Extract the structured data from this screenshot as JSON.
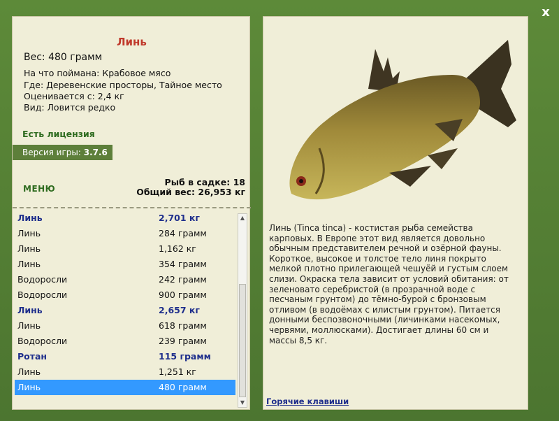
{
  "window": {
    "close_label": "x"
  },
  "fish_card": {
    "title": "Линь",
    "weight": "Вес: 480 грамм",
    "caught_on": "На что поймана: Крабовое мясо",
    "location": "Где: Деревенские просторы, Тайное место",
    "valued_from": "Оценивается с: 2,4 кг",
    "kind": "Вид: Ловится редко"
  },
  "license": "Есть лицензия",
  "version": {
    "label": "Версия игры:",
    "value": "3.7.6"
  },
  "menu_label": "МЕНЮ",
  "stats": {
    "fish_in_keepnet": "Рыб в садке: 18",
    "total_weight": "Общий вес: 26,953 кг"
  },
  "catch_list": [
    {
      "name": "Линь",
      "weight": "2,701 кг",
      "bold": true,
      "selected": false
    },
    {
      "name": "Линь",
      "weight": "284 грамм",
      "bold": false,
      "selected": false
    },
    {
      "name": "Линь",
      "weight": "1,162 кг",
      "bold": false,
      "selected": false
    },
    {
      "name": "Линь",
      "weight": "354 грамм",
      "bold": false,
      "selected": false
    },
    {
      "name": "Водоросли",
      "weight": "242 грамм",
      "bold": false,
      "selected": false
    },
    {
      "name": "Водоросли",
      "weight": "900 грамм",
      "bold": false,
      "selected": false
    },
    {
      "name": "Линь",
      "weight": "2,657 кг",
      "bold": true,
      "selected": false
    },
    {
      "name": "Линь",
      "weight": "618 грамм",
      "bold": false,
      "selected": false
    },
    {
      "name": "Водоросли",
      "weight": "239 грамм",
      "bold": false,
      "selected": false
    },
    {
      "name": "Ротан",
      "weight": "115 грамм",
      "bold": true,
      "selected": false
    },
    {
      "name": "Линь",
      "weight": "1,251 кг",
      "bold": false,
      "selected": false
    },
    {
      "name": "Линь",
      "weight": "480 грамм",
      "bold": false,
      "selected": true
    }
  ],
  "description": "Линь (Tinca tinca) - костистая рыба семейства карповых. В Европе этот вид является довольно обычным представителем речной и озёрной фауны. Короткое, высокое и толстое тело линя покрыто мелкой плотно прилегающей чешуёй и густым слоем слизи. Окраска тела зависит от условий обитания: от зеленовато серебристой (в прозрачной воде с песчаным грунтом) до тёмно-бурой с бронзовым отливом (в водоёмах с илистым грунтом). Питается донными беспозвоночными (личинками насекомых, червями, моллюсками). Достигает длины 60 см и массы 8,5 кг.",
  "hotkeys_label": "Горячие клавиши",
  "colors": {
    "accent": "#3399ff",
    "title_red": "#c0392b",
    "bold_blue": "#1f2f8c",
    "green": "#2e6b1f"
  },
  "icons": {
    "close": "close-icon",
    "scroll_up": "chevron-up-icon",
    "scroll_down": "chevron-down-icon"
  }
}
